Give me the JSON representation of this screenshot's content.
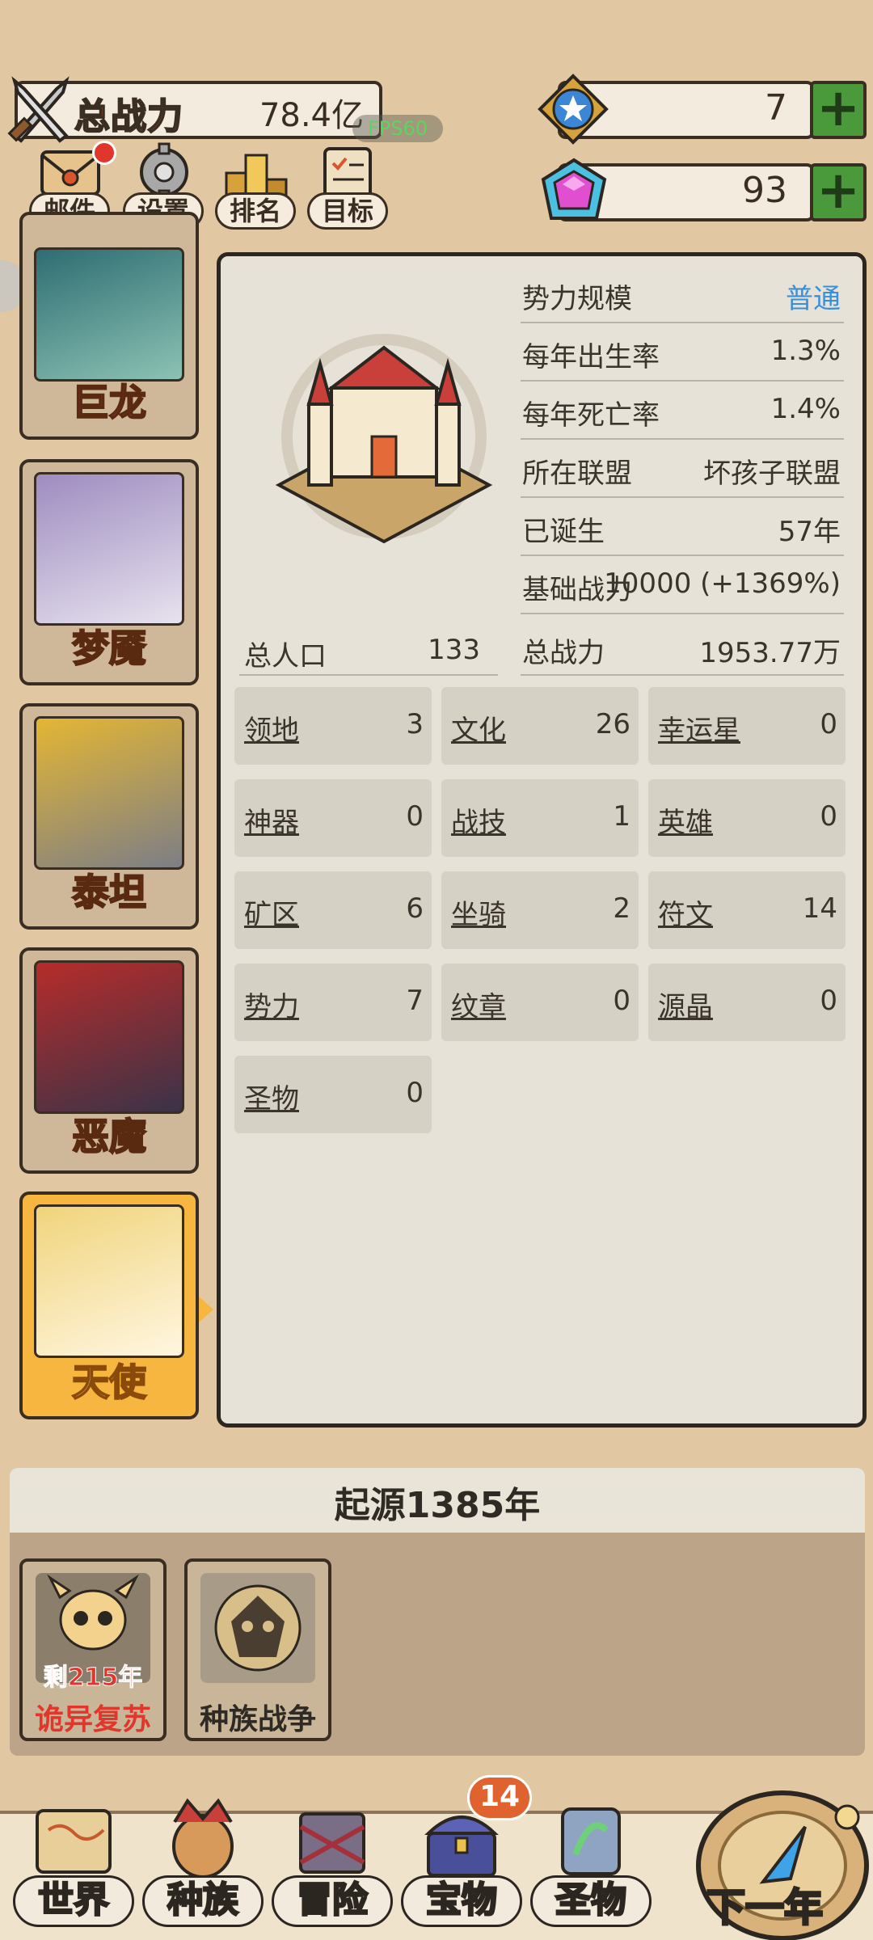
{
  "hud": {
    "power_label": "总战力",
    "power_value": "78.4亿",
    "fps": "FPS60",
    "resource1_value": "7",
    "resource2_value": "93"
  },
  "top_buttons": [
    {
      "label": "邮件"
    },
    {
      "label": "设置"
    },
    {
      "label": "排名"
    },
    {
      "label": "目标"
    }
  ],
  "races": [
    {
      "name": "巨龙",
      "color": "#e23ad6"
    },
    {
      "name": "梦魇",
      "color": "#f6a22c"
    },
    {
      "name": "泰坦",
      "color": "#f6a22c"
    },
    {
      "name": "恶魔",
      "color": "#f6a22c"
    },
    {
      "name": "天使",
      "color": "#f6a22c"
    }
  ],
  "info": {
    "rows": [
      {
        "key": "势力规模",
        "value": "普通"
      },
      {
        "key": "每年出生率",
        "value": "1.3%"
      },
      {
        "key": "每年死亡率",
        "value": "1.4%"
      },
      {
        "key": "所在联盟",
        "value": "坏孩子联盟"
      },
      {
        "key": "已诞生",
        "value": "57年"
      },
      {
        "key": "基础战力",
        "value": "10000 (+1369%)"
      },
      {
        "key": "总战力",
        "value": "1953.77万"
      }
    ],
    "population_label": "总人口",
    "population_value": "133"
  },
  "stats": [
    {
      "key": "领地",
      "value": "3"
    },
    {
      "key": "文化",
      "value": "26"
    },
    {
      "key": "幸运星",
      "value": "0"
    },
    {
      "key": "神器",
      "value": "0"
    },
    {
      "key": "战技",
      "value": "1"
    },
    {
      "key": "英雄",
      "value": "0"
    },
    {
      "key": "矿区",
      "value": "6"
    },
    {
      "key": "坐骑",
      "value": "2"
    },
    {
      "key": "符文",
      "value": "14"
    },
    {
      "key": "势力",
      "value": "7"
    },
    {
      "key": "纹章",
      "value": "0"
    },
    {
      "key": "源晶",
      "value": "0"
    },
    {
      "key": "圣物",
      "value": "0"
    }
  ],
  "origin": "起源1385年",
  "events": [
    {
      "sub": "剩215年",
      "name": "诡异复苏",
      "name_color": "#e0362c"
    },
    {
      "sub": "",
      "name": "种族战争",
      "name_color": "#2f2a24"
    }
  ],
  "nav": [
    {
      "label": "世界"
    },
    {
      "label": "种族"
    },
    {
      "label": "冒险"
    },
    {
      "label": "宝物",
      "badge": "14"
    },
    {
      "label": "圣物"
    }
  ],
  "next_label": "下一年"
}
